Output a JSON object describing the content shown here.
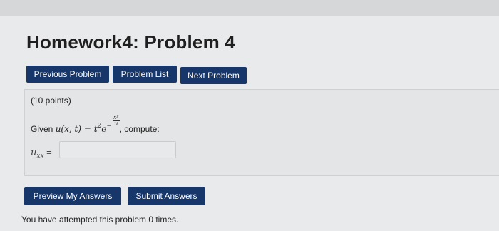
{
  "page": {
    "title": "Homework4: Problem 4"
  },
  "nav": {
    "previous_label": "Previous Problem",
    "list_label": "Problem List",
    "next_label": "Next Problem"
  },
  "problem": {
    "points": "(10 points)",
    "given_prefix": "Given",
    "function": "u(x, t) = t",
    "exponent_power": "2",
    "exp_base": "e",
    "exp_sign": "−",
    "exp_numerator": "x²",
    "exp_denominator": "u",
    "given_suffix": ", compute:",
    "answer_label": "u",
    "answer_subscript": "xx",
    "answer_equals": " =",
    "answer_value": ""
  },
  "actions": {
    "preview_label": "Preview My Answers",
    "submit_label": "Submit Answers"
  },
  "status": {
    "attempts_text": "You have attempted this problem 0 times."
  },
  "colors": {
    "button_bg": "#17376b",
    "page_bg": "#e9eaec"
  }
}
